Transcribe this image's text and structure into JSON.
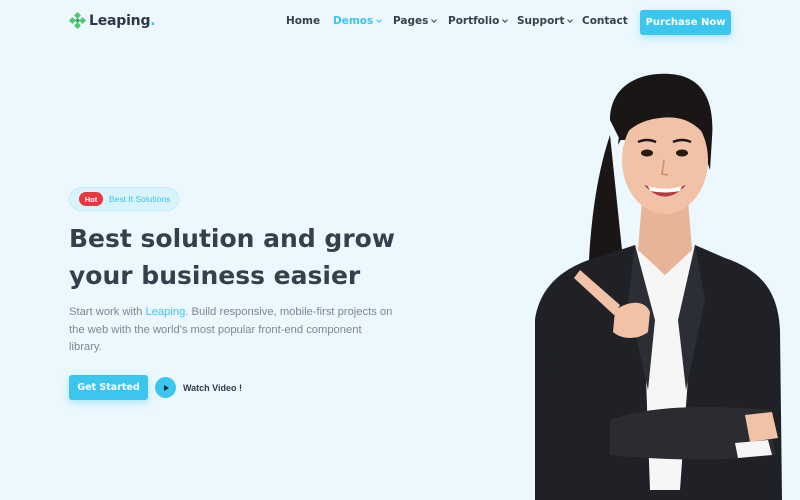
{
  "brand": {
    "name": "Leaping",
    "dot": ".",
    "accent": "#3bc6ef"
  },
  "nav": {
    "items": [
      {
        "label": "Home",
        "caret": false,
        "active": false
      },
      {
        "label": "Demos",
        "caret": true,
        "active": true
      },
      {
        "label": "Pages",
        "caret": true,
        "active": false
      },
      {
        "label": "Portfolio",
        "caret": true,
        "active": false
      },
      {
        "label": "Support",
        "caret": true,
        "active": false
      },
      {
        "label": "Contact",
        "caret": false,
        "active": false
      }
    ],
    "purchase_label": "Purchase Now"
  },
  "hero": {
    "badge": "Hot",
    "badge_text": "Best It Solutions",
    "title_line1": "Best solution and grow",
    "title_line2": "your business easier",
    "desc_line1_prefix": "Start work with ",
    "desc_line1_highlight": "Leaping",
    "desc_line1_suffix": ". Build responsive, mobile-first projects on",
    "desc_line2": "the web with the world's most popular front-end component",
    "desc_line3": "library.",
    "cta_label": "Get Started",
    "video_label": "Watch Video !"
  },
  "colors": {
    "background": "#ecf8fe",
    "hot": "#e8373e",
    "text": "#34404d",
    "muted": "#7c8693"
  }
}
